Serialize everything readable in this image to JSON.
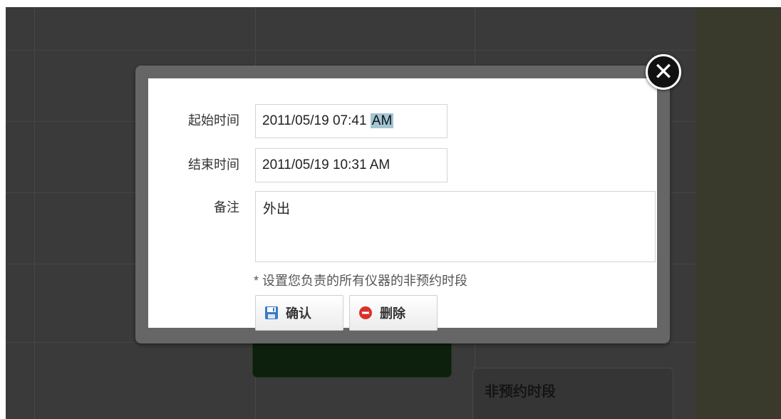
{
  "background": {
    "card_title": "非预约时段"
  },
  "dialog": {
    "close_icon": "close-icon",
    "start_label": "起始时间",
    "start_value": "2011/05/19 07:41",
    "start_ampm": "AM",
    "end_label": "结束时间",
    "end_value": "2011/05/19 10:31 AM",
    "note_label": "备注",
    "note_value": "外出",
    "hint": "* 设置您负责的所有仪器的非预约时段",
    "confirm_label": "确认",
    "confirm_icon": "floppy-disk-icon",
    "delete_label": "删除",
    "delete_icon": "minus-circle-icon"
  },
  "colors": {
    "backdrop": "#3a3a3a",
    "dialog_frame": "#666666",
    "selection": "#a3c5d4",
    "delete_red": "#d9302c",
    "save_blue": "#3a79c5"
  }
}
